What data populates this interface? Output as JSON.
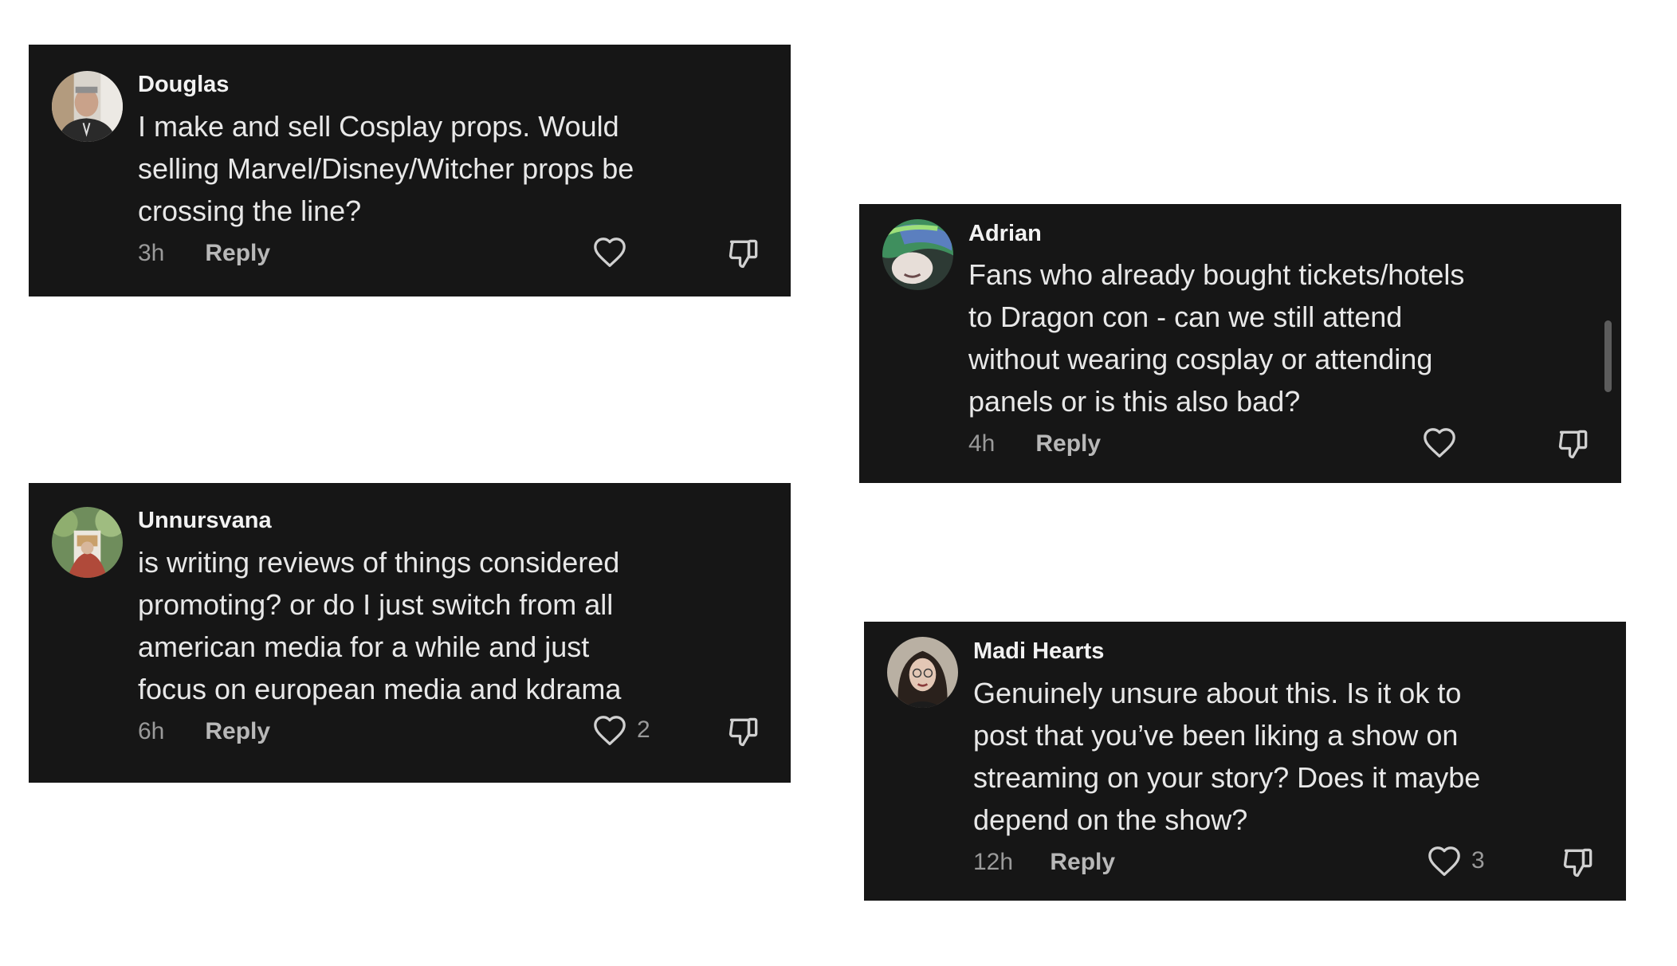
{
  "comments": [
    {
      "username": "Douglas",
      "text": "I make and sell Cosplay props. Would\nselling Marvel/Disney/Witcher props be\ncrossing the line?",
      "time": "3h",
      "reply_label": "Reply",
      "likes": ""
    },
    {
      "username": "Adrian",
      "text": "Fans who already bought tickets/hotels\nto Dragon con - can we still attend\nwithout wearing cosplay or attending\npanels or is this also bad?",
      "time": "4h",
      "reply_label": "Reply",
      "likes": ""
    },
    {
      "username": "Unnursvana",
      "text": "is writing reviews of things considered\npromoting? or do I just switch from all\namerican media for a while and just\nfocus on european media and kdrama",
      "time": "6h",
      "reply_label": "Reply",
      "likes": "2"
    },
    {
      "username": "Madi Hearts",
      "text": "Genuinely unsure about this. Is it ok to\npost that you’ve been liking a show on\nstreaming on your story? Does it maybe\ndepend on the show?",
      "time": "12h",
      "reply_label": "Reply",
      "likes": "3"
    }
  ],
  "icons": {
    "like": "heart-outline-icon",
    "dislike": "thumbs-down-outline-icon"
  },
  "colors": {
    "card_background": "#161616",
    "text": "#e8e8e8",
    "muted_text": "#9a9a9a",
    "page_background": "#ffffff"
  }
}
